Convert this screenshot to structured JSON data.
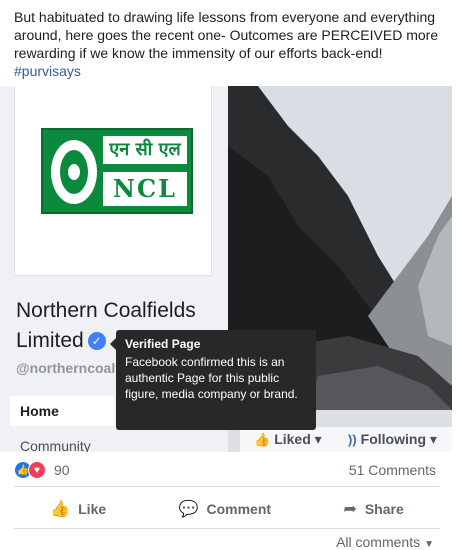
{
  "post": {
    "text": "But habituated to drawing life lessons from everyone and everything around, here goes the recent one- Outcomes are PERCEIVED more rewarding if we know the immensity of our efforts back-end!",
    "hashtag": "#purvisays"
  },
  "shared_page": {
    "logo": {
      "hindi_text": "एन सी एल",
      "abbr": "NCL"
    },
    "name_line1": "Northern Coalfields",
    "name_line2": "Limited",
    "verified_icon": "check-icon",
    "handle": "@northerncoalfields",
    "nav": {
      "home": "Home",
      "community": "Community"
    },
    "cover_buttons": {
      "liked": "Liked",
      "following": "Following"
    }
  },
  "tooltip": {
    "title": "Verified Page",
    "body": "Facebook confirmed this is an authentic Page for this public figure, media company or brand."
  },
  "engagement": {
    "reaction_count": "90",
    "comments": "51 Comments"
  },
  "actions": {
    "like": "Like",
    "comment": "Comment",
    "share": "Share"
  },
  "footer": {
    "all_comments": "All comments"
  },
  "colors": {
    "ncl_green": "#0b8a3e",
    "facebook_blue": "#4267b2",
    "verified_blue": "#4080ff",
    "tooltip_bg": "#282828"
  }
}
